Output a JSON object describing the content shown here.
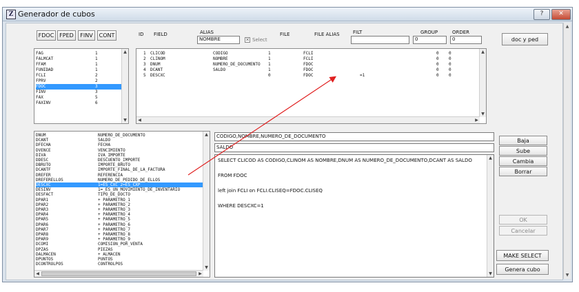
{
  "window": {
    "title": "Generador de cubos",
    "icon_glyph": "Z",
    "help_label": "?",
    "close_label": "✕"
  },
  "tabs": [
    "FDOC",
    "FPED",
    "FINV",
    "CONT"
  ],
  "grid_header": {
    "id": "ID",
    "field": "FIELD",
    "alias": "ALIAS",
    "alias_value": "NOMBRE",
    "select_label": "Select",
    "file": "FILE",
    "file_alias": "FILE ALIAS",
    "filt": "FILT",
    "filt_value": "",
    "group": "GROUP",
    "group_value": "0",
    "order": "ORDER",
    "order_value": "0"
  },
  "doc_button": "doc y ped",
  "files_list": [
    {
      "name": "FAG",
      "num": "1"
    },
    {
      "name": "FALMCAT",
      "num": "1"
    },
    {
      "name": "FFAM",
      "num": "1"
    },
    {
      "name": "FUNIDAD",
      "num": "1"
    },
    {
      "name": "FCLI",
      "num": "2"
    },
    {
      "name": "FPRV",
      "num": "2"
    },
    {
      "name": "FDOC",
      "num": "3",
      "selected": true
    },
    {
      "name": "FINV",
      "num": "3"
    },
    {
      "name": "FAX",
      "num": "5"
    },
    {
      "name": "FAXINV",
      "num": "6"
    }
  ],
  "selected_fields": [
    {
      "id": "1",
      "field": "CLICOD",
      "alias": "CODIGO",
      "select": "1",
      "file": "FCLI",
      "falias": "",
      "filt": "",
      "group": "0",
      "order": "0"
    },
    {
      "id": "2",
      "field": "CLINOM",
      "alias": "NOMBRE",
      "select": "1",
      "file": "FCLI",
      "falias": "",
      "filt": "",
      "group": "0",
      "order": "0"
    },
    {
      "id": "3",
      "field": "DNUM",
      "alias": "NUMERO_DE_DOCUMENTO",
      "select": "1",
      "file": "FDOC",
      "falias": "",
      "filt": "",
      "group": "0",
      "order": "0"
    },
    {
      "id": "4",
      "field": "DCANT",
      "alias": "SALDO",
      "select": "1",
      "file": "FDOC",
      "falias": "",
      "filt": "",
      "group": "0",
      "order": "0"
    },
    {
      "id": "5",
      "field": "DESCXC",
      "alias": "",
      "select": "0",
      "file": "FDOC",
      "falias": "",
      "filt": "=1",
      "group": "0",
      "order": "0"
    }
  ],
  "field_list": [
    {
      "name": "DNUM",
      "desc": "NUMERO_DE_DOCUMENTO"
    },
    {
      "name": "DCANT",
      "desc": "SALDO"
    },
    {
      "name": "DFECHA",
      "desc": "FECHA"
    },
    {
      "name": "DVENCE",
      "desc": "VENCIMIENTO"
    },
    {
      "name": "DIVA",
      "desc": "IVA_IMPORTE"
    },
    {
      "name": "DDESC",
      "desc": "DESCUENTO_IMPORTE"
    },
    {
      "name": "DBRUTO",
      "desc": "IMPORTE_BRUTO"
    },
    {
      "name": "DCANTF",
      "desc": "IMPORTE_FINAL_DE_LA_FACTURA"
    },
    {
      "name": "DREFER",
      "desc": "REFERENCIA"
    },
    {
      "name": "DREFERELLOS",
      "desc": "NUMERO_DE_PEDIDO_DE_ELLOS"
    },
    {
      "name": "DESCXC",
      "desc": "1=ES_CXC    2=ES_CXP",
      "selected": true
    },
    {
      "name": "DESINV",
      "desc": "1=_ES_UN_MOVIMIENTO_DE_INVENTARIO"
    },
    {
      "name": "DESFACT",
      "desc": "TIPO_DE_DOCTO"
    },
    {
      "name": "DPAR1",
      "desc": "+ PARAMETRO_1"
    },
    {
      "name": "DPAR2",
      "desc": "+ PARAMETRO_2"
    },
    {
      "name": "DPAR3",
      "desc": "+ PARAMETRO_3"
    },
    {
      "name": "DPAR4",
      "desc": "+ PARAMETRO_4"
    },
    {
      "name": "DPAR5",
      "desc": "+ PARAMETRO_5"
    },
    {
      "name": "DPAR6",
      "desc": "+ PARAMETRO_6"
    },
    {
      "name": "DPAR7",
      "desc": "+ PARAMETRO_7"
    },
    {
      "name": "DPAR8",
      "desc": "+ PARAMETRO_8"
    },
    {
      "name": "DPAR9",
      "desc": "+ PARAMETRO_9"
    },
    {
      "name": "DCOMI",
      "desc": "COMISION_POR_VENTA"
    },
    {
      "name": "DPZAS",
      "desc": "PIEZAS"
    },
    {
      "name": "DALMACEN",
      "desc": "+ ALMACEN"
    },
    {
      "name": "DPUNTOS",
      "desc": "PUNTOS"
    },
    {
      "name": "DCONTROLPOS",
      "desc": "CONTROLPOS"
    }
  ],
  "group_field": "CODIGO,NOMBRE,NUMERO_DE_DOCUMENTO",
  "sum_field": "SALDO",
  "sql_lines": [
    "SELECT CLICOD AS CODIGO,CLINOM AS NOMBRE,DNUM AS NUMERO_DE_DOCUMENTO,DCANT AS SALDO",
    "FROM FDOC",
    "left join FCLI on FCLI.CLISEQ=FDOC.CLISEQ",
    "WHERE DESCXC=1"
  ],
  "side_buttons": {
    "baja": "Baja",
    "sube": "Sube",
    "cambia": "Cambia",
    "borrar": "Borrar",
    "ok": "OK",
    "cancel": "Cancelar",
    "make_select": "MAKE SELECT",
    "genera": "Genera cubo"
  },
  "colors": {
    "selection": "#3399ff",
    "arrow": "#e02020",
    "close": "#c54a33"
  }
}
